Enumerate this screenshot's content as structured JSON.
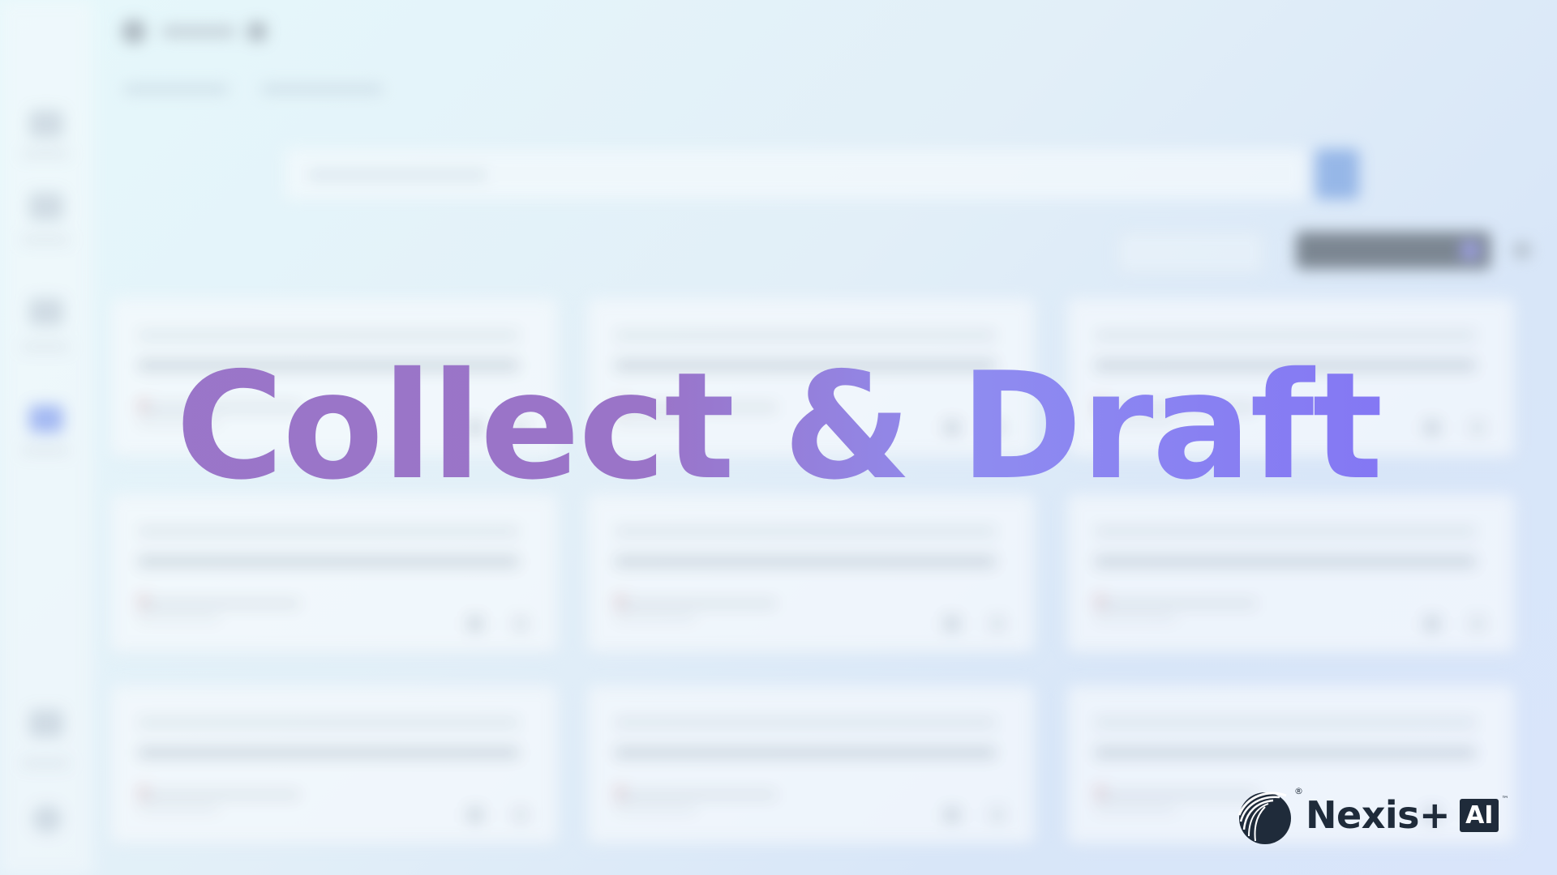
{
  "overlay": {
    "title": "Collect & Draft"
  },
  "brand": {
    "name": "Nexis+",
    "badge": "AI",
    "registered_mark": "®",
    "trademark": "™"
  },
  "colors": {
    "title_gradient_start": "#9a76c9",
    "title_gradient_end": "#7f6ff5",
    "brand_text": "#1f2b3a"
  }
}
